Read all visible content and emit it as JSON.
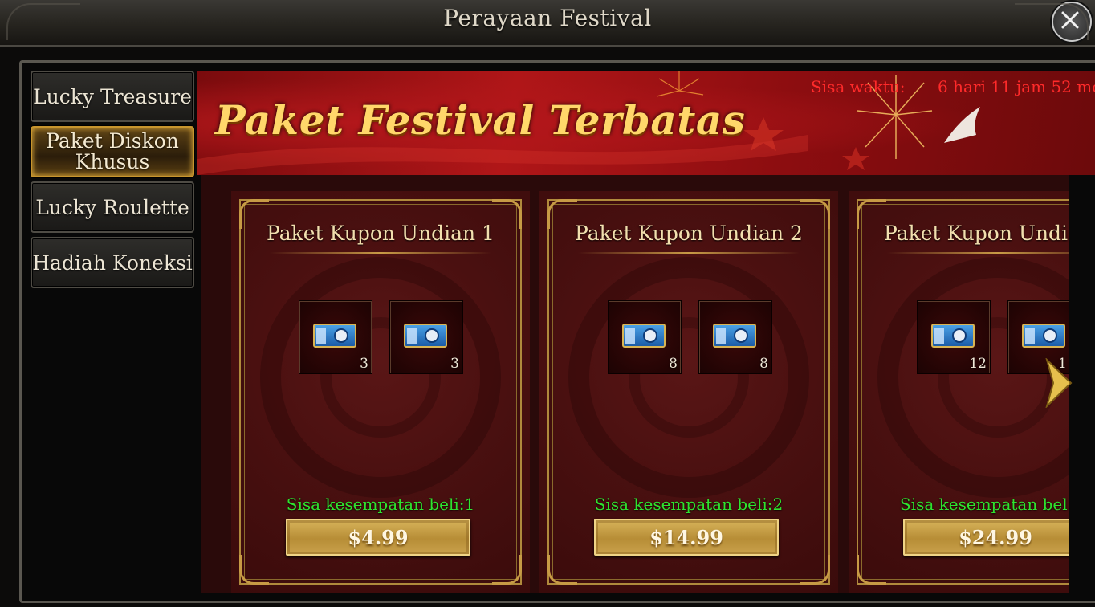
{
  "window": {
    "title": "Perayaan Festival"
  },
  "sidebar": {
    "items": [
      {
        "label": "Lucky Treasure",
        "active": false
      },
      {
        "label_line1": "Paket Diskon",
        "label_line2": "Khusus",
        "active": true
      },
      {
        "label": "Lucky Roulette",
        "active": false
      },
      {
        "label": "Hadiah Koneksi",
        "active": false
      }
    ]
  },
  "banner": {
    "title": "Paket Festival Terbatas",
    "timer_label": "Sisa waktu:",
    "timer_value": "6 hari 11 jam 52 me"
  },
  "packages": [
    {
      "title": "Paket Kupon Undian 1",
      "items": [
        {
          "icon": "lottery-coupon-icon",
          "qty": "3"
        },
        {
          "icon": "lottery-coupon-icon",
          "qty": "3"
        }
      ],
      "remaining": "Sisa kesempatan beli:1",
      "price": "$4.99"
    },
    {
      "title": "Paket Kupon Undian 2",
      "items": [
        {
          "icon": "lottery-coupon-icon",
          "qty": "8"
        },
        {
          "icon": "lottery-coupon-icon",
          "qty": "8"
        }
      ],
      "remaining": "Sisa kesempatan beli:2",
      "price": "$14.99"
    },
    {
      "title": "Paket Kupon Undi",
      "items": [
        {
          "icon": "lottery-coupon-icon",
          "qty": "12"
        },
        {
          "icon": "lottery-coupon-icon",
          "qty": "1"
        }
      ],
      "remaining": "Sisa kesempatan bel",
      "price": "$24.99"
    }
  ],
  "colors": {
    "timer": "#ff2a2a",
    "remaining": "#2fe32f",
    "banner_title": "#ffd76a",
    "price_button": "#c9a14b"
  }
}
